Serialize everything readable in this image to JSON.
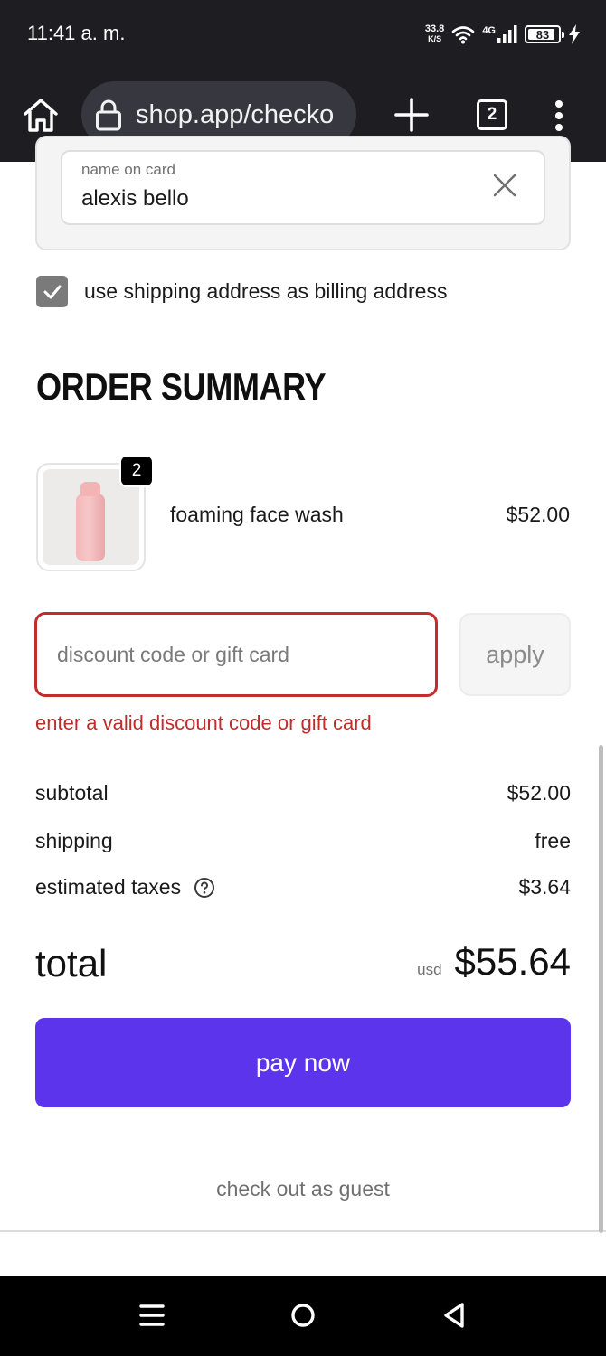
{
  "status_bar": {
    "time": "11:41 a. m.",
    "net_speed_value": "33.8",
    "net_speed_unit": "K/S",
    "network_type": "4G",
    "battery_level": "83",
    "icons": [
      "wifi-icon",
      "signal-icon",
      "battery-icon",
      "charging-icon"
    ]
  },
  "browser": {
    "url": "shop.app/checko",
    "tab_count": "2",
    "icons": [
      "home-icon",
      "lock-icon",
      "plus-icon",
      "tabs-icon",
      "more-menu-icon"
    ]
  },
  "payment": {
    "name_label": "name on card",
    "name_value": "alexis bello",
    "billing_same_label": "use shipping address as billing address",
    "billing_same_checked": true
  },
  "order_summary": {
    "title": "ORDER SUMMARY",
    "items": [
      {
        "name": "foaming face wash",
        "price": "$52.00",
        "quantity": "2"
      }
    ],
    "discount": {
      "placeholder": "discount code or gift card",
      "value": "",
      "apply_label": "apply",
      "error": "enter a valid discount code or gift card"
    },
    "subtotal_label": "subtotal",
    "subtotal_value": "$52.00",
    "shipping_label": "shipping",
    "shipping_value": "free",
    "taxes_label": "estimated taxes",
    "taxes_value": "$3.64",
    "total_label": "total",
    "total_currency": "usd",
    "total_value": "$55.64",
    "pay_label": "pay now",
    "guest_label": "check out as guest"
  },
  "colors": {
    "accent": "#5b34ec",
    "error": "#c12d2d",
    "checkbox": "#7a7a7a",
    "top_bar": "#1e1e22"
  }
}
